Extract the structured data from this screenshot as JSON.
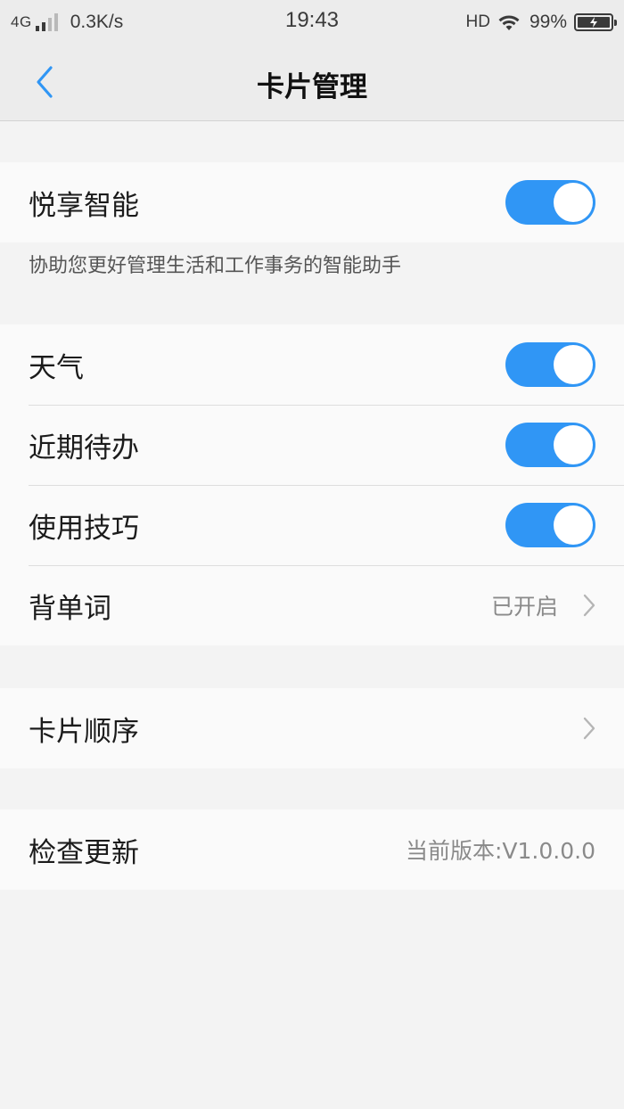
{
  "status_bar": {
    "network": "4G",
    "speed": "0.3K/s",
    "time": "19:43",
    "hd": "HD",
    "battery": "99%"
  },
  "header": {
    "back_icon": "chevron-left-icon",
    "title": "卡片管理"
  },
  "smart": {
    "label": "悦享智能",
    "enabled": true,
    "description": "协助您更好管理生活和工作事务的智能助手"
  },
  "cards": [
    {
      "label": "天气",
      "type": "toggle",
      "enabled": true
    },
    {
      "label": "近期待办",
      "type": "toggle",
      "enabled": true
    },
    {
      "label": "使用技巧",
      "type": "toggle",
      "enabled": true
    },
    {
      "label": "背单词",
      "type": "link",
      "value": "已开启"
    }
  ],
  "order": {
    "label": "卡片顺序"
  },
  "update": {
    "label": "检查更新",
    "version": "当前版本:V1.0.0.0"
  },
  "colors": {
    "accent": "#3096f5",
    "background": "#f3f3f3",
    "card": "#fafafa"
  }
}
